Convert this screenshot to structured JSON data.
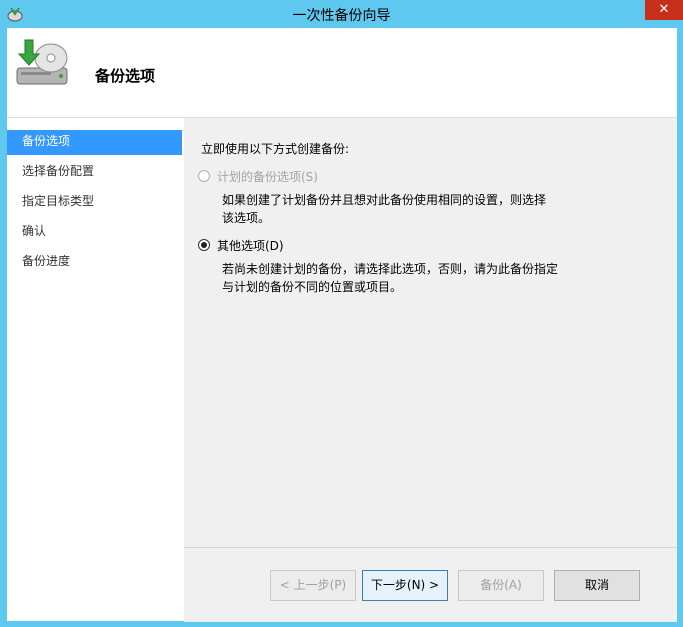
{
  "window": {
    "title": "一次性备份向导",
    "close_symbol": "✕"
  },
  "header": {
    "title": "备份选项",
    "icon": "backup-disk-icon"
  },
  "sidebar": {
    "items": [
      {
        "label": "备份选项",
        "active": true
      },
      {
        "label": "选择备份配置",
        "active": false
      },
      {
        "label": "指定目标类型",
        "active": false
      },
      {
        "label": "确认",
        "active": false
      },
      {
        "label": "备份进度",
        "active": false
      }
    ]
  },
  "main": {
    "intro": "立即使用以下方式创建备份:",
    "options": [
      {
        "label": "计划的备份选项(S)",
        "selected": false,
        "enabled": false,
        "desc_line1": "如果创建了计划备份并且想对此备份使用相同的设置，则选择",
        "desc_line2": "该选项。"
      },
      {
        "label": "其他选项(D)",
        "selected": true,
        "enabled": true,
        "desc_line1": "若尚未创建计划的备份，请选择此选项，否则，请为此备份指定",
        "desc_line2": "与计划的备份不同的位置或项目。"
      }
    ]
  },
  "footer": {
    "prev": "< 上一步(P)",
    "next": "下一步(N) >",
    "backup": "备份(A)",
    "cancel": "取消"
  },
  "colors": {
    "titlebar": "#5ec8ef",
    "selection": "#3399ff",
    "close": "#c7311b"
  }
}
